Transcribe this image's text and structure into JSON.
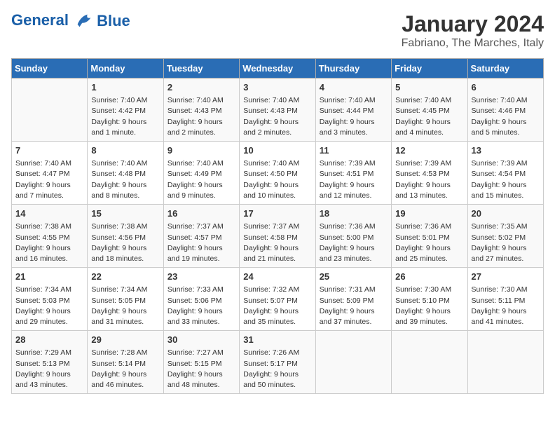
{
  "header": {
    "logo_line1": "General",
    "logo_line2": "Blue",
    "month_year": "January 2024",
    "location": "Fabriano, The Marches, Italy"
  },
  "days_of_week": [
    "Sunday",
    "Monday",
    "Tuesday",
    "Wednesday",
    "Thursday",
    "Friday",
    "Saturday"
  ],
  "weeks": [
    [
      {
        "day": "",
        "info": ""
      },
      {
        "day": "1",
        "info": "Sunrise: 7:40 AM\nSunset: 4:42 PM\nDaylight: 9 hours\nand 1 minute."
      },
      {
        "day": "2",
        "info": "Sunrise: 7:40 AM\nSunset: 4:43 PM\nDaylight: 9 hours\nand 2 minutes."
      },
      {
        "day": "3",
        "info": "Sunrise: 7:40 AM\nSunset: 4:43 PM\nDaylight: 9 hours\nand 2 minutes."
      },
      {
        "day": "4",
        "info": "Sunrise: 7:40 AM\nSunset: 4:44 PM\nDaylight: 9 hours\nand 3 minutes."
      },
      {
        "day": "5",
        "info": "Sunrise: 7:40 AM\nSunset: 4:45 PM\nDaylight: 9 hours\nand 4 minutes."
      },
      {
        "day": "6",
        "info": "Sunrise: 7:40 AM\nSunset: 4:46 PM\nDaylight: 9 hours\nand 5 minutes."
      }
    ],
    [
      {
        "day": "7",
        "info": "Sunrise: 7:40 AM\nSunset: 4:47 PM\nDaylight: 9 hours\nand 7 minutes."
      },
      {
        "day": "8",
        "info": "Sunrise: 7:40 AM\nSunset: 4:48 PM\nDaylight: 9 hours\nand 8 minutes."
      },
      {
        "day": "9",
        "info": "Sunrise: 7:40 AM\nSunset: 4:49 PM\nDaylight: 9 hours\nand 9 minutes."
      },
      {
        "day": "10",
        "info": "Sunrise: 7:40 AM\nSunset: 4:50 PM\nDaylight: 9 hours\nand 10 minutes."
      },
      {
        "day": "11",
        "info": "Sunrise: 7:39 AM\nSunset: 4:51 PM\nDaylight: 9 hours\nand 12 minutes."
      },
      {
        "day": "12",
        "info": "Sunrise: 7:39 AM\nSunset: 4:53 PM\nDaylight: 9 hours\nand 13 minutes."
      },
      {
        "day": "13",
        "info": "Sunrise: 7:39 AM\nSunset: 4:54 PM\nDaylight: 9 hours\nand 15 minutes."
      }
    ],
    [
      {
        "day": "14",
        "info": "Sunrise: 7:38 AM\nSunset: 4:55 PM\nDaylight: 9 hours\nand 16 minutes."
      },
      {
        "day": "15",
        "info": "Sunrise: 7:38 AM\nSunset: 4:56 PM\nDaylight: 9 hours\nand 18 minutes."
      },
      {
        "day": "16",
        "info": "Sunrise: 7:37 AM\nSunset: 4:57 PM\nDaylight: 9 hours\nand 19 minutes."
      },
      {
        "day": "17",
        "info": "Sunrise: 7:37 AM\nSunset: 4:58 PM\nDaylight: 9 hours\nand 21 minutes."
      },
      {
        "day": "18",
        "info": "Sunrise: 7:36 AM\nSunset: 5:00 PM\nDaylight: 9 hours\nand 23 minutes."
      },
      {
        "day": "19",
        "info": "Sunrise: 7:36 AM\nSunset: 5:01 PM\nDaylight: 9 hours\nand 25 minutes."
      },
      {
        "day": "20",
        "info": "Sunrise: 7:35 AM\nSunset: 5:02 PM\nDaylight: 9 hours\nand 27 minutes."
      }
    ],
    [
      {
        "day": "21",
        "info": "Sunrise: 7:34 AM\nSunset: 5:03 PM\nDaylight: 9 hours\nand 29 minutes."
      },
      {
        "day": "22",
        "info": "Sunrise: 7:34 AM\nSunset: 5:05 PM\nDaylight: 9 hours\nand 31 minutes."
      },
      {
        "day": "23",
        "info": "Sunrise: 7:33 AM\nSunset: 5:06 PM\nDaylight: 9 hours\nand 33 minutes."
      },
      {
        "day": "24",
        "info": "Sunrise: 7:32 AM\nSunset: 5:07 PM\nDaylight: 9 hours\nand 35 minutes."
      },
      {
        "day": "25",
        "info": "Sunrise: 7:31 AM\nSunset: 5:09 PM\nDaylight: 9 hours\nand 37 minutes."
      },
      {
        "day": "26",
        "info": "Sunrise: 7:30 AM\nSunset: 5:10 PM\nDaylight: 9 hours\nand 39 minutes."
      },
      {
        "day": "27",
        "info": "Sunrise: 7:30 AM\nSunset: 5:11 PM\nDaylight: 9 hours\nand 41 minutes."
      }
    ],
    [
      {
        "day": "28",
        "info": "Sunrise: 7:29 AM\nSunset: 5:13 PM\nDaylight: 9 hours\nand 43 minutes."
      },
      {
        "day": "29",
        "info": "Sunrise: 7:28 AM\nSunset: 5:14 PM\nDaylight: 9 hours\nand 46 minutes."
      },
      {
        "day": "30",
        "info": "Sunrise: 7:27 AM\nSunset: 5:15 PM\nDaylight: 9 hours\nand 48 minutes."
      },
      {
        "day": "31",
        "info": "Sunrise: 7:26 AM\nSunset: 5:17 PM\nDaylight: 9 hours\nand 50 minutes."
      },
      {
        "day": "",
        "info": ""
      },
      {
        "day": "",
        "info": ""
      },
      {
        "day": "",
        "info": ""
      }
    ]
  ]
}
